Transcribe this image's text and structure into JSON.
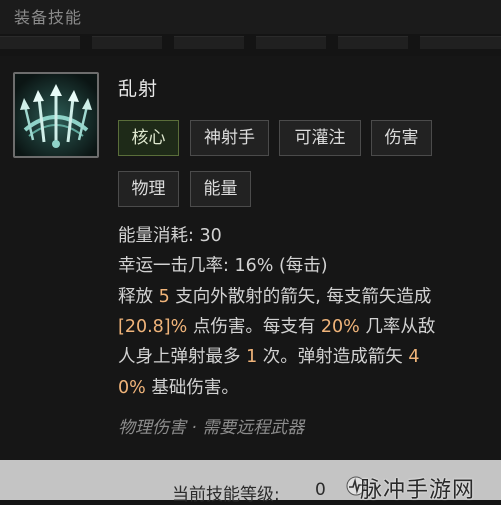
{
  "header": {
    "title": "装备技能"
  },
  "skill": {
    "name": "乱射",
    "icon": "triple-arrow-bow-icon",
    "tags": [
      "核心",
      "神射手",
      "可灌注",
      "伤害",
      "物理",
      "能量"
    ],
    "stats": {
      "energy_cost_label": "能量消耗:",
      "energy_cost_value": "30",
      "lucky_label": "幸运一击几率:",
      "lucky_value": "16%",
      "lucky_suffix": "(每击)"
    },
    "description": {
      "l1a": "释放",
      "l1_num": "5",
      "l1b": "支向外散射的箭矢, 每支箭矢造成",
      "l2_num": "[20.8]%",
      "l2a": "点伤害。每支有",
      "l2_num2": "20%",
      "l2b": "几率从敌",
      "l3a": "人身上弹射最多",
      "l3_num": "1",
      "l3b": "次。弹射造成箭矢",
      "l3_num2": "4",
      "l4_num": "0%",
      "l4a": "基础伤害。"
    },
    "requirement": "物理伤害 · 需要远程武器"
  },
  "footer": {
    "level_label": "当前技能等级:",
    "level_value": "0",
    "watermark": "脉冲手游网"
  },
  "colors": {
    "background": "#141414",
    "highlight_number": "#f0b47a",
    "primary_tag": "#1e2a18",
    "icon_glow": "#8fd3c8"
  }
}
